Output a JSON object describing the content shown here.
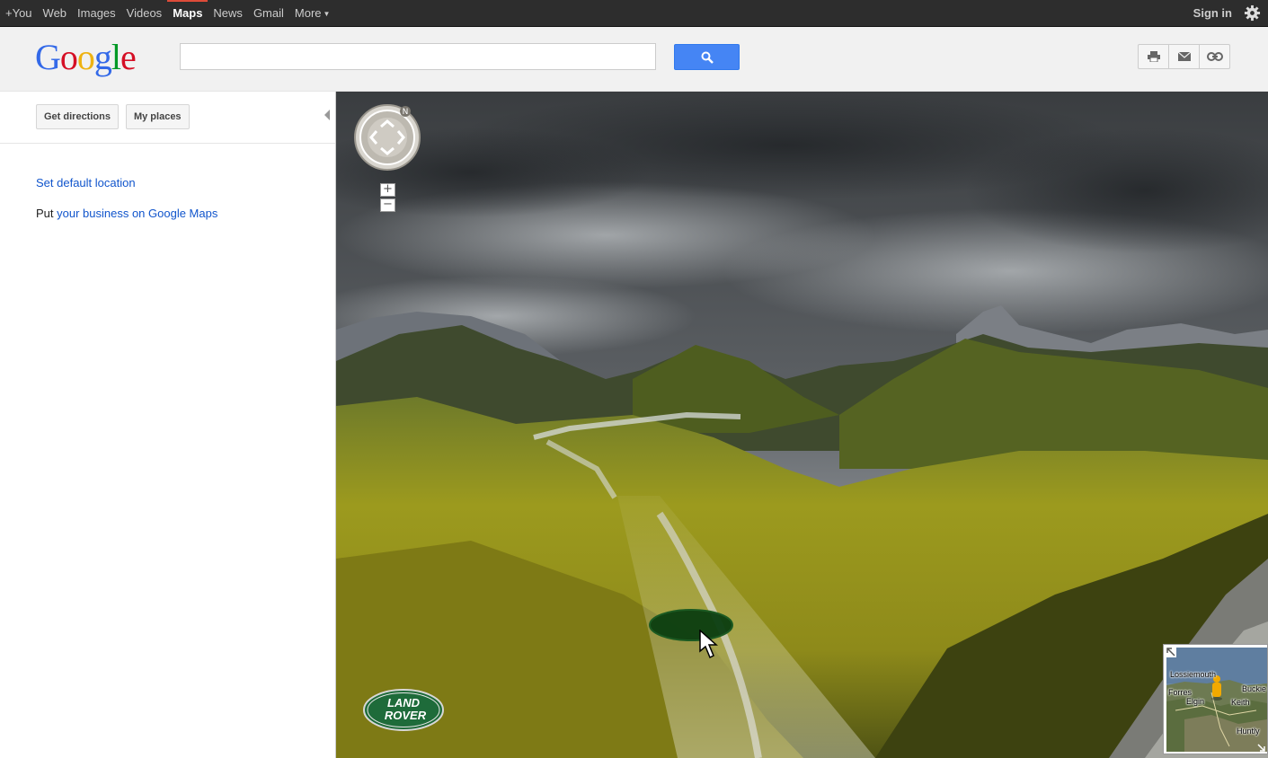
{
  "topbar": {
    "nav": [
      "+You",
      "Web",
      "Images",
      "Videos",
      "Maps",
      "News",
      "Gmail",
      "More"
    ],
    "active": "Maps",
    "signin_label": "Sign in"
  },
  "header": {
    "logo_text": "Google",
    "search_value": "",
    "tool_icons": [
      "print-icon",
      "email-icon",
      "link-icon"
    ]
  },
  "sidebar": {
    "get_directions_label": "Get directions",
    "my_places_label": "My places",
    "set_default_label": "Set default location",
    "put_text": "Put ",
    "business_link": "your business on Google Maps"
  },
  "streetview": {
    "zoom_in": "+",
    "zoom_out": "−",
    "compass_letter": "N",
    "brand_line1": "LAND",
    "brand_line2": "ROVER"
  },
  "minimap": {
    "labels": [
      "Lossiemouth",
      "Buckie",
      "Forres",
      "Elgin",
      "Keith",
      "Huntly"
    ]
  },
  "colors": {
    "topbar_bg": "#2d2d2d",
    "active_accent": "#dd4b39",
    "search_blue": "#4585f4",
    "link_blue": "#1155cc"
  }
}
